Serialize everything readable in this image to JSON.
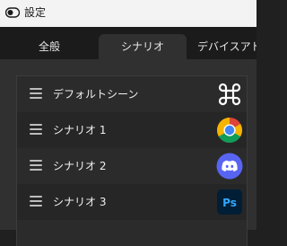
{
  "window": {
    "title": "設定"
  },
  "tabs": [
    {
      "label": "全般",
      "active": false
    },
    {
      "label": "シナリオ",
      "active": true
    },
    {
      "label": "デバイスアドレ",
      "active": false
    }
  ],
  "scenarios": [
    {
      "label": "デフォルトシーン",
      "icon": "command-key-icon"
    },
    {
      "label": "シナリオ 1",
      "icon": "chrome-icon"
    },
    {
      "label": "シナリオ 2",
      "icon": "discord-icon"
    },
    {
      "label": "シナリオ 3",
      "icon": "photoshop-icon",
      "icon_text": "Ps"
    }
  ],
  "colors": {
    "titlebar": "#f3f3f3",
    "background": "#202020",
    "panel": "#303030",
    "discord": "#5865F2",
    "photoshop_bg": "#001E36",
    "photoshop_fg": "#31A8FF"
  }
}
